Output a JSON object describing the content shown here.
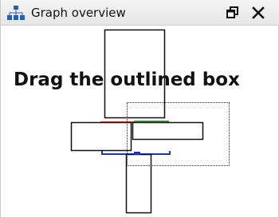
{
  "window": {
    "title": "Graph overview",
    "icons": {
      "title": "hierarchy-icon",
      "restore": "restore-window-icon",
      "close": "close-icon"
    }
  },
  "canvas": {
    "hint": "Drag the outlined box"
  },
  "colors": {
    "accent_title_icon": "#1f5fbf",
    "edge_red": "#e03030",
    "edge_green": "#2aa02a",
    "edge_blue": "#2030c0",
    "node_stroke": "#111111"
  }
}
